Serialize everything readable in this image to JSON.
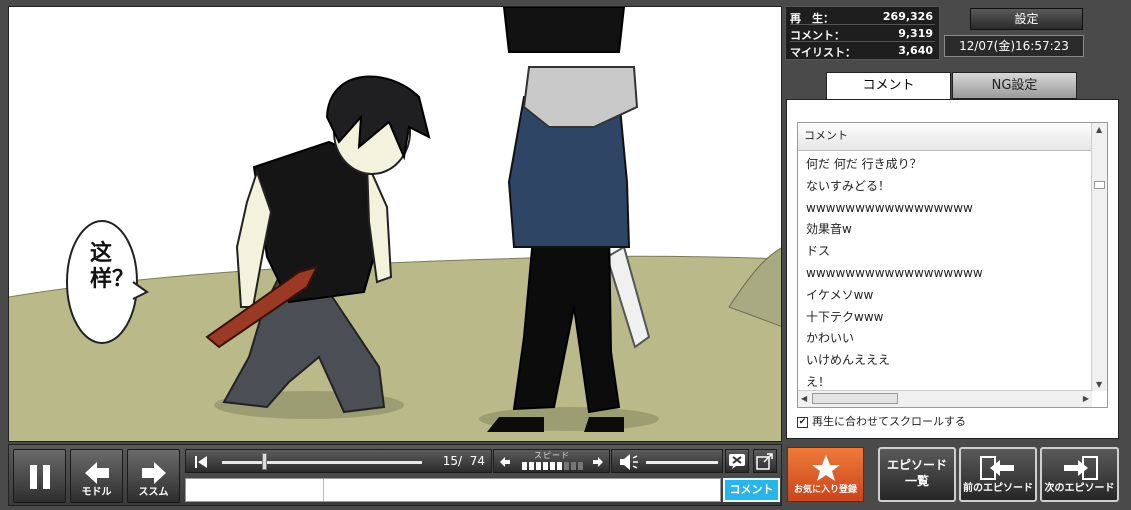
{
  "video": {
    "speech_bubble": "这样？"
  },
  "controls": {
    "back_label": "モドル",
    "forward_label": "ススム",
    "time_display": "15/  74",
    "speed_label": "スピード",
    "speed_level": {
      "filled": 6,
      "total": 9
    },
    "seek_progress": 0.2,
    "volume_level": 1.0,
    "comment_submit_label": "コメント"
  },
  "stats": {
    "views_label": "再　生：",
    "views_value": "269,326",
    "comments_label": "コメント：",
    "comments_value": "9,319",
    "mylist_label": "マイリスト：",
    "mylist_value": "3,640"
  },
  "header": {
    "settings_label": "設定",
    "datetime": "12/07(金)16:57:23"
  },
  "tabs": [
    {
      "label": "コメント",
      "active": true
    },
    {
      "label": "NG設定",
      "active": false
    }
  ],
  "comments": {
    "column_header": "コメント",
    "items": [
      "何だ 何だ 行き成り？",
      "ないすみどる！",
      "wwwwwwwwwwwwwwwww",
      "効果音w",
      "ドス",
      "wwwwwwwwwwwwwwwwww",
      "イケメソww",
      "十下テクwww",
      "かわいい",
      "いけめんえええ",
      "え！"
    ],
    "scroll_option": "再生に合わせてスクロールする",
    "scroll_option_checked": true
  },
  "buttons": {
    "favorite_label": "お気に入り登録",
    "episode_list_label_1": "エピソード",
    "episode_list_label_2": "一覧",
    "prev_episode_label": "前のエピソード",
    "next_episode_label": "次のエピソード"
  },
  "colors": {
    "accent_orange": "#e0602a",
    "comment_submit": "#29b5e8",
    "ground": "#b9b98a"
  }
}
